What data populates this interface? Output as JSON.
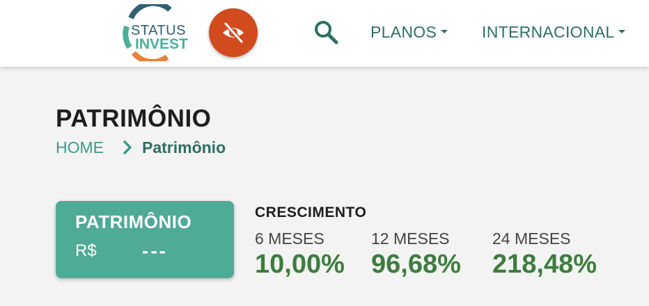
{
  "header": {
    "logo": {
      "line1": "STATUS",
      "line2": "INVEST"
    },
    "icons": {
      "hide_values": "eye-slash-icon",
      "search": "search-icon"
    },
    "nav": [
      {
        "label": "PLANOS"
      },
      {
        "label": "INTERNACIONAL"
      }
    ]
  },
  "page": {
    "title": "PATRIMÔNIO",
    "breadcrumb": {
      "home": "HOME",
      "current": "Patrimônio"
    }
  },
  "summary_card": {
    "title": "PATRIMÔNIO",
    "currency": "R$",
    "value": "---"
  },
  "growth": {
    "title": "CRESCIMENTO",
    "periods": [
      {
        "label": "6 MESES",
        "value": "10,00%"
      },
      {
        "label": "12 MESES",
        "value": "96,68%"
      },
      {
        "label": "24 MESES",
        "value": "218,48%"
      }
    ]
  },
  "colors": {
    "accent": "#4faa96",
    "nav_text": "#2e6f63",
    "hide_button": "#d24b1f",
    "growth_value": "#3d7d3e",
    "logo_dark": "#2f5f73",
    "logo_orange": "#e8823a"
  }
}
